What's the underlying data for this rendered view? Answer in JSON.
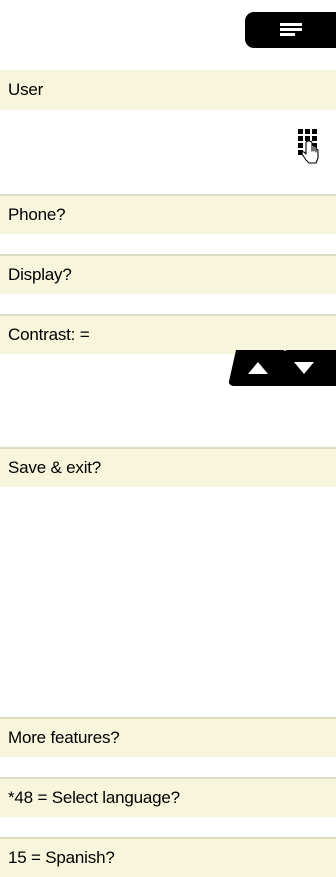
{
  "menu": {
    "icon": "menu-icon"
  },
  "rows": {
    "user": "User",
    "phone": "Phone?",
    "display": "Display?",
    "contrast": "Contrast: =",
    "save_exit": "Save & exit?",
    "more_features": "More features?",
    "select_language": "*48 = Select language?",
    "spanish": "15 = Spanish?"
  },
  "keypad": {
    "icon": "keypad-hand-icon"
  },
  "arrows": {
    "up_icon": "arrow-up-icon",
    "separator": "/",
    "down_icon": "arrow-down-icon"
  }
}
